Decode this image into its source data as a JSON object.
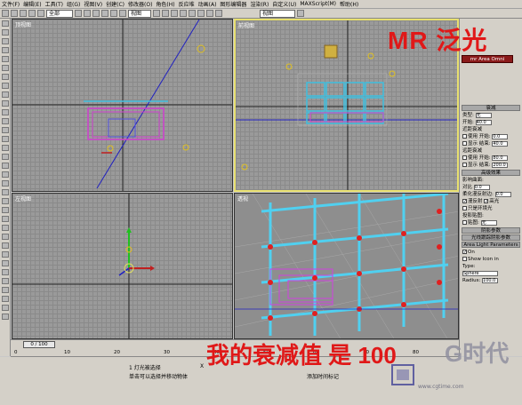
{
  "menu": {
    "items": [
      "文件(F)",
      "编辑(E)",
      "工具(T)",
      "组(G)",
      "视图(V)",
      "创建(C)",
      "修改器(O)",
      "角色(H)",
      "反应堆",
      "动画(A)",
      "图形编辑器",
      "渲染(R)",
      "自定义(U)",
      "MAXScript(M)",
      "帮助(H)"
    ]
  },
  "toolbar": {
    "selection_filter": "全部",
    "view_dropdown": "视图",
    "coord_dropdown": "视图"
  },
  "viewports": {
    "top_label": "顶视图",
    "front_label": "前视图",
    "left_label": "左视图",
    "persp_label": "透视"
  },
  "overlay": {
    "title": "MR 泛光",
    "caption": "我的衰减值 是 100",
    "watermark": "G时代",
    "watermark_url": "www.cgtime.com"
  },
  "command_panel": {
    "red_button": "mr Area Omni",
    "section_decay": "衰减",
    "type_label": "类型:",
    "type_value": "无",
    "start_label": "开始:",
    "start_value": "40.0",
    "near_atten": "近距衰减",
    "use_label": "使用",
    "start2_label": "开始:",
    "start2_value": "0.0",
    "show_label": "显示",
    "end_label": "结束:",
    "end_value": "40.0",
    "far_atten": "远距衰减",
    "use2_label": "使用",
    "start3_label": "开始:",
    "start3_value": "80.0",
    "show2_label": "显示",
    "end2_label": "结束:",
    "end2_value": "200.0",
    "adv_effects": "高级效果",
    "affect_surface": "影响曲面:",
    "contrast_label": "对比",
    "contrast_value": "0.0",
    "soften_label": "柔化漫反射边:",
    "soften_value": "0.0",
    "diffuse_label": "漫反射",
    "specular_label": "高光",
    "ambient_label": "只是环境光",
    "projector_label": "投影贴图:",
    "map_label": "贴图:",
    "map_value": "无",
    "shadow_params": "阴影参数",
    "shadow_map_params": "光线跟踪阴影参数",
    "area_light_params": "Area Light Parameters",
    "on_label": "On",
    "show_icon_label": "Show Icon in",
    "type2_label": "Type:",
    "type2_value": "Sphere",
    "radius_label": "Radius:",
    "radius_value": "100.0"
  },
  "timeslider": {
    "frame_label": "0 / 100"
  },
  "ruler": {
    "ticks": [
      "0",
      "10",
      "20",
      "30",
      "40",
      "50",
      "60",
      "70",
      "80"
    ]
  },
  "status": {
    "selected": "1 灯光被选择",
    "prompt": "单击可以选择并移动物体",
    "add_time": "添加时间标记",
    "x_label": "X"
  }
}
